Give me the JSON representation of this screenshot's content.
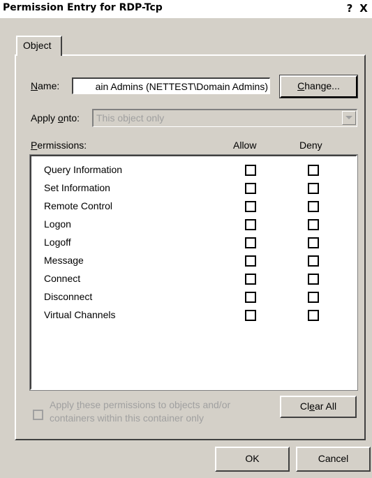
{
  "window": {
    "title": "Permission Entry for RDP-Tcp",
    "help_label": "?",
    "close_label": "X"
  },
  "tabs": [
    {
      "label": "Object",
      "selected": true
    }
  ],
  "name": {
    "label_prefix": "",
    "label_accel": "N",
    "label_rest": "ame:",
    "value": "ain Admins (NETTEST\\Domain Admins)"
  },
  "change_button": {
    "accel": "C",
    "rest": "hange..."
  },
  "apply_onto": {
    "label_prefix": "Apply ",
    "label_accel": "o",
    "label_rest": "nto:",
    "value": "This object only"
  },
  "permissions": {
    "header_accel": "P",
    "header_rest": "ermissions:",
    "allow_header": "Allow",
    "deny_header": "Deny",
    "items": [
      {
        "name": "Query Information",
        "allow": false,
        "deny": false
      },
      {
        "name": "Set Information",
        "allow": false,
        "deny": false
      },
      {
        "name": "Remote Control",
        "allow": false,
        "deny": false
      },
      {
        "name": "Logon",
        "allow": false,
        "deny": false
      },
      {
        "name": "Logoff",
        "allow": false,
        "deny": false
      },
      {
        "name": "Message",
        "allow": false,
        "deny": false
      },
      {
        "name": "Connect",
        "allow": false,
        "deny": false
      },
      {
        "name": "Disconnect",
        "allow": false,
        "deny": false
      },
      {
        "name": "Virtual Channels",
        "allow": false,
        "deny": false
      }
    ]
  },
  "apply_checkbox": {
    "line1_prefix": "Apply ",
    "line1_accel": "t",
    "line1_rest": "hese permissions to objects and/or",
    "line2": "containers within this container only",
    "checked": false,
    "enabled": false
  },
  "clear_all_button": {
    "prefix": "Cl",
    "accel": "e",
    "rest": "ar All"
  },
  "ok_button": "OK",
  "cancel_button": "Cancel"
}
